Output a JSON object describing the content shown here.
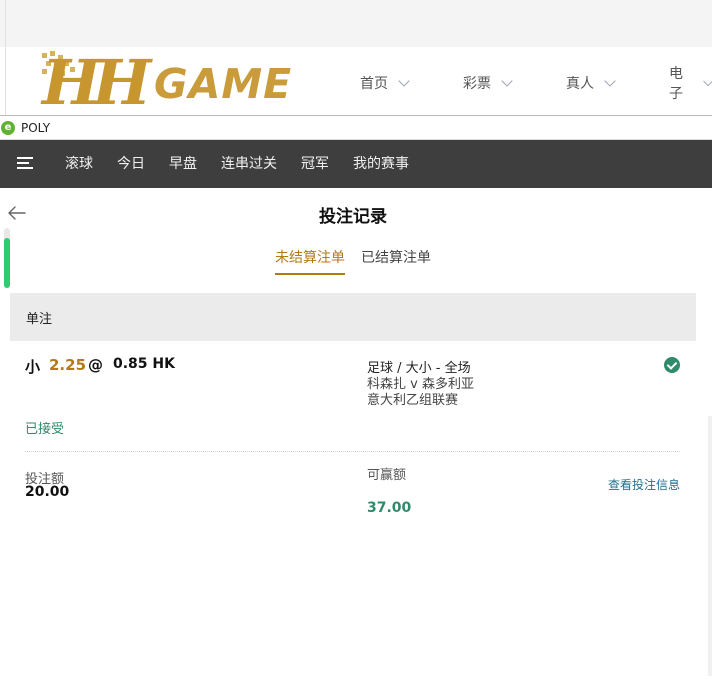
{
  "site": {
    "logo_text": "HH GAME",
    "menu": [
      {
        "label": "首页"
      },
      {
        "label": "彩票"
      },
      {
        "label": "真人"
      },
      {
        "label": "电子"
      }
    ]
  },
  "window": {
    "title": "POLY",
    "icon": "ie-icon"
  },
  "nav": {
    "menu_icon": "hamburger-icon",
    "tabs": [
      {
        "label": "滚球"
      },
      {
        "label": "今日"
      },
      {
        "label": "早盘"
      },
      {
        "label": "连串过关"
      },
      {
        "label": "冠军"
      },
      {
        "label": "我的赛事"
      }
    ]
  },
  "page": {
    "title": "投注记录",
    "back_icon": "back-arrow-icon",
    "tabs": {
      "unsettled": "未结算注单",
      "settled": "已结算注单"
    },
    "section_label": "单注"
  },
  "bet": {
    "selection": "小",
    "handicap": "2.25",
    "at": "@",
    "odds": "0.85 HK",
    "market": "足球 / 大小 - 全场",
    "match": "科森扎 v 森多利亚",
    "league": "意大利乙组联赛",
    "status": "已接受",
    "status_icon": "check-circle-icon",
    "stake_label": "投注额",
    "stake_value": "20.00",
    "win_label": "可赢额",
    "win_value": "37.00",
    "view_info_label": "查看投注信息"
  },
  "colors": {
    "accent": "#b37a17",
    "success": "#2e8b6b",
    "nav_bg": "#3e3e3e",
    "link": "#1f6f8b"
  }
}
